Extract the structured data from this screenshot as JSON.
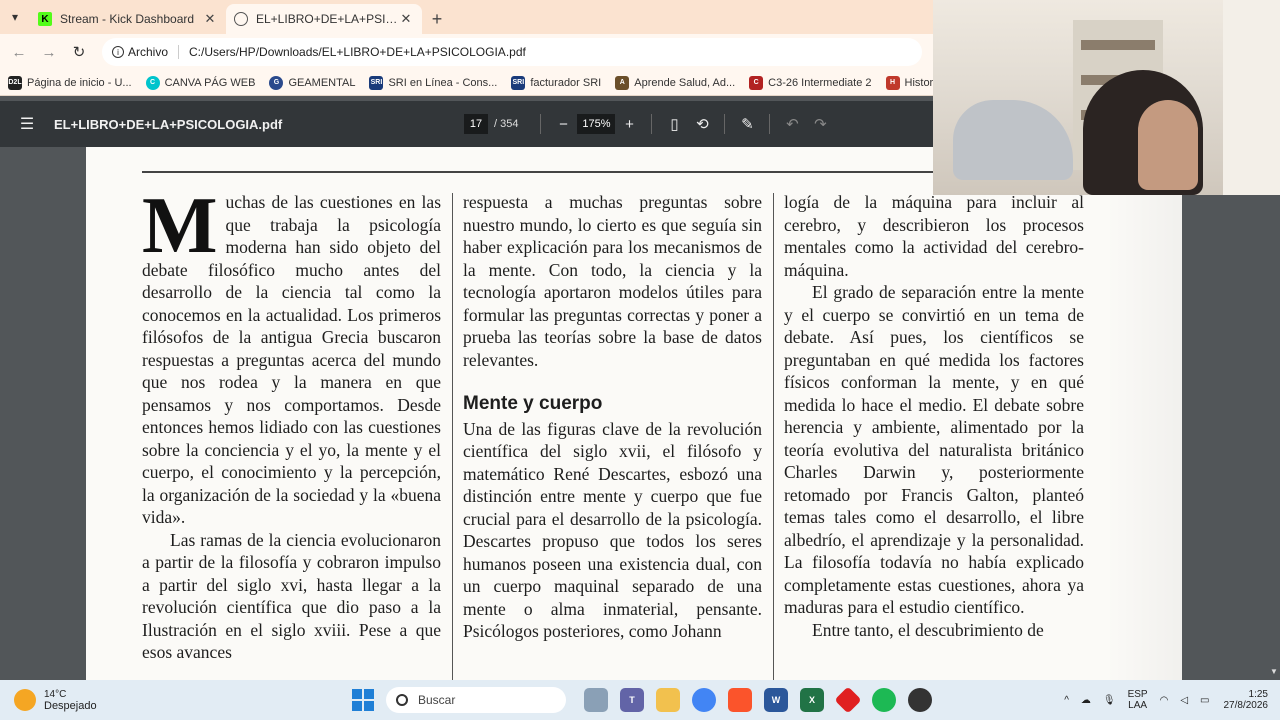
{
  "tabs": [
    {
      "title": "Stream - Kick Dashboard",
      "favicon": "K",
      "favicon_color": "#53fc18",
      "active": false
    },
    {
      "title": "EL+LIBRO+DE+LA+PSICOLOGIA.pdf",
      "favicon": "globe",
      "favicon_color": "#555555",
      "active": true
    }
  ],
  "toolbar": {
    "site_chip": "Archivo",
    "url": "C:/Users/HP/Downloads/EL+LIBRO+DE+LA+PSICOLOGIA.pdf"
  },
  "bookmarks": [
    {
      "label": "Página de inicio - U...",
      "icon": "D2L",
      "color": "#222222"
    },
    {
      "label": "CANVA PÁG WEB",
      "icon": "C",
      "color": "#00c4cc"
    },
    {
      "label": "GEAMENTAL",
      "icon": "G",
      "color": "#2b4a8c"
    },
    {
      "label": "SRI en Línea - Cons...",
      "icon": "SRI",
      "color": "#1a3b7a"
    },
    {
      "label": "facturador SRI",
      "icon": "SRI",
      "color": "#1a3b7a"
    },
    {
      "label": "Aprende Salud, Ad...",
      "icon": "A",
      "color": "#6b4f2a"
    },
    {
      "label": "C3-26 Intermediate 2",
      "icon": "C",
      "color": "#b22222"
    },
    {
      "label": "Historia de la Psicol...",
      "icon": "H",
      "color": "#c0392b"
    }
  ],
  "pdf": {
    "title": "EL+LIBRO+DE+LA+PSICOLOGIA.pdf",
    "page_current": "17",
    "page_total": "/ 354",
    "zoom": "175%"
  },
  "document": {
    "dropcap": "M",
    "col1": [
      "uchas de las cuestiones en las que trabaja la psicología moderna han sido objeto del debate filosófico mucho antes del desarrollo de la ciencia tal como la conocemos en la actualidad. Los primeros filósofos de la antigua Grecia buscaron respuestas a preguntas acerca del mundo que nos rodea y la manera en que pensamos y nos comportamos. Desde entonces hemos lidiado con las cuestiones sobre la conciencia y el yo, la mente y el cuerpo, el conocimiento y la percepción, la organización de la sociedad y la «buena vida».",
      "Las ramas de la ciencia evolucionaron a partir de la filosofía y cobraron impulso a partir del siglo xvi, hasta llegar a la revolución científica que dio paso a la Ilustración en el siglo xviii. Pese a que esos avances"
    ],
    "col2_top": "respuesta a muchas preguntas sobre nuestro mundo, lo cierto es que seguía sin haber explicación para los mecanismos de la mente. Con todo, la ciencia y la tecnología aportaron modelos útiles para formular las preguntas correctas y poner a prueba las teorías sobre la base de datos relevantes.",
    "heading": "Mente y cuerpo",
    "col2_bottom": "Una de las figuras clave de la revolución científica del siglo xvii, el filósofo y matemático René Descartes, esbozó una distinción entre mente y cuerpo que fue crucial para el desarrollo de la psicología. Descartes propuso que todos los seres humanos poseen una existencia dual, con un cuerpo maquinal separado de una mente o alma inmaterial, pensante. Psicólogos posteriores, como Johann",
    "col3": [
      "logía de la máquina para incluir al cerebro, y describieron los procesos mentales como la actividad del cerebro-máquina.",
      "El grado de separación entre la mente y el cuerpo se convirtió en un tema de debate. Así pues, los científicos se preguntaban en qué medida los factores físicos conforman la mente, y en qué medida lo hace el medio. El debate sobre herencia y ambiente, alimentado por la teoría evolutiva del naturalista británico Charles Darwin y, posteriormente retomado por Francis Galton, planteó temas tales como el desarrollo, el libre albedrío, el aprendizaje y la personalidad. La filosofía todavía no había explicado completamente estas cuestiones, ahora ya maduras para el estudio científico.",
      "Entre tanto, el descubrimiento de"
    ]
  },
  "taskbar": {
    "temp": "14°C",
    "condition": "Despejado",
    "search_placeholder": "Buscar",
    "lang_top": "ESP",
    "lang_bottom": "LAA",
    "time": "1:25",
    "date": "27/8/2026"
  }
}
